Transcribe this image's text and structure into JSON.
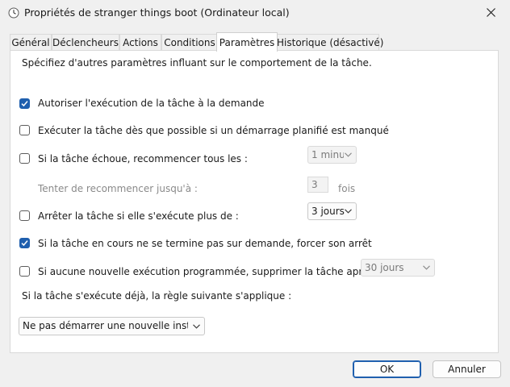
{
  "window": {
    "title": "Propriétés de stranger things boot (Ordinateur local)"
  },
  "tabs": [
    {
      "label": "Général"
    },
    {
      "label": "Déclencheurs"
    },
    {
      "label": "Actions"
    },
    {
      "label": "Conditions"
    },
    {
      "label": "Paramètres"
    },
    {
      "label": "Historique (désactivé)"
    }
  ],
  "active_tab": "Paramètres",
  "settings": {
    "intro": "Spécifiez d'autres paramètres influant sur le comportement de la tâche.",
    "allow_on_demand": {
      "label": "Autoriser l'exécution de la tâche à la demande",
      "checked": true
    },
    "run_asap": {
      "label": "Exécuter la tâche dès que possible si un démarrage planifié est manqué",
      "checked": false
    },
    "restart_on_fail": {
      "label": "Si la tâche échoue, recommencer tous les :",
      "checked": false,
      "interval": "1 minu"
    },
    "restart_attempts": {
      "label": "Tenter de recommencer jusqu'à :",
      "value": "3",
      "unit": "fois"
    },
    "stop_if_longer": {
      "label": "Arrêter la tâche si elle s'exécute plus de :",
      "checked": false,
      "duration": "3 jours"
    },
    "force_stop": {
      "label": "Si la tâche en cours ne se termine pas sur demande, forcer son arrêt",
      "checked": true
    },
    "delete_after": {
      "label": "Si aucune nouvelle exécution programmée, supprimer la tâche après :",
      "checked": false,
      "duration": "30 jours"
    },
    "rule_label": "Si la tâche s'exécute déjà, la règle suivante s'applique :",
    "rule_value": "Ne pas démarrer une nouvelle instance"
  },
  "buttons": {
    "ok": "OK",
    "cancel": "Annuler"
  },
  "colors": {
    "accent": "#1f5fae"
  }
}
